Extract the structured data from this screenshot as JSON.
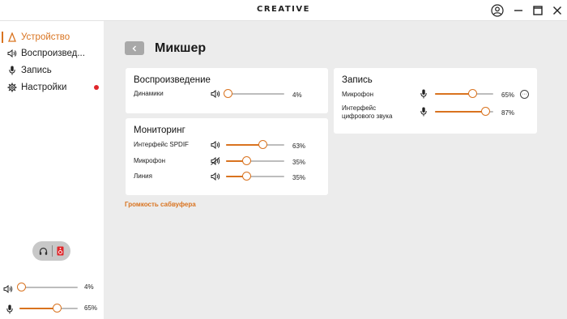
{
  "titlebar": {
    "brand": "CREATIVE"
  },
  "sidebar": {
    "items": [
      {
        "label": "Устройство",
        "icon": "device-icon",
        "active": true
      },
      {
        "label": "Воспроизвед...",
        "icon": "speaker-icon",
        "active": false
      },
      {
        "label": "Запись",
        "icon": "microphone-icon",
        "active": false
      },
      {
        "label": "Настройки",
        "icon": "gear-icon",
        "active": false,
        "notification": true
      }
    ],
    "output_toggle": {
      "options": [
        "headphones-icon",
        "speaker-box-icon"
      ]
    },
    "sliders": [
      {
        "icon": "speaker-icon",
        "value": 4,
        "label": "4%"
      },
      {
        "icon": "microphone-icon",
        "value": 65,
        "label": "65%"
      }
    ]
  },
  "main": {
    "title": "Микшер",
    "playback": {
      "title": "Воспроизведение",
      "rows": [
        {
          "label": "Динамики",
          "icon": "speaker-icon",
          "value": 4,
          "label_pct": "4%"
        }
      ]
    },
    "monitoring": {
      "title": "Мониторинг",
      "rows": [
        {
          "label": "Интерфейс SPDIF",
          "icon": "speaker-icon",
          "value": 63,
          "label_pct": "63%"
        },
        {
          "label": "Микрофон",
          "icon": "speaker-muted-icon",
          "value": 35,
          "label_pct": "35%"
        },
        {
          "label": "Линия",
          "icon": "speaker-icon",
          "value": 35,
          "label_pct": "35%"
        }
      ]
    },
    "recording": {
      "title": "Запись",
      "rows": [
        {
          "label": "Микрофон",
          "icon": "microphone-icon",
          "value": 65,
          "label_pct": "65%"
        },
        {
          "label": "Интерфейс цифрового звука",
          "icon": "microphone-icon",
          "value": 87,
          "label_pct": "87%"
        }
      ]
    },
    "subwoofer_link": "Громкость сабвуфера"
  },
  "colors": {
    "accent": "#d9731f",
    "notification": "#e0262a"
  }
}
